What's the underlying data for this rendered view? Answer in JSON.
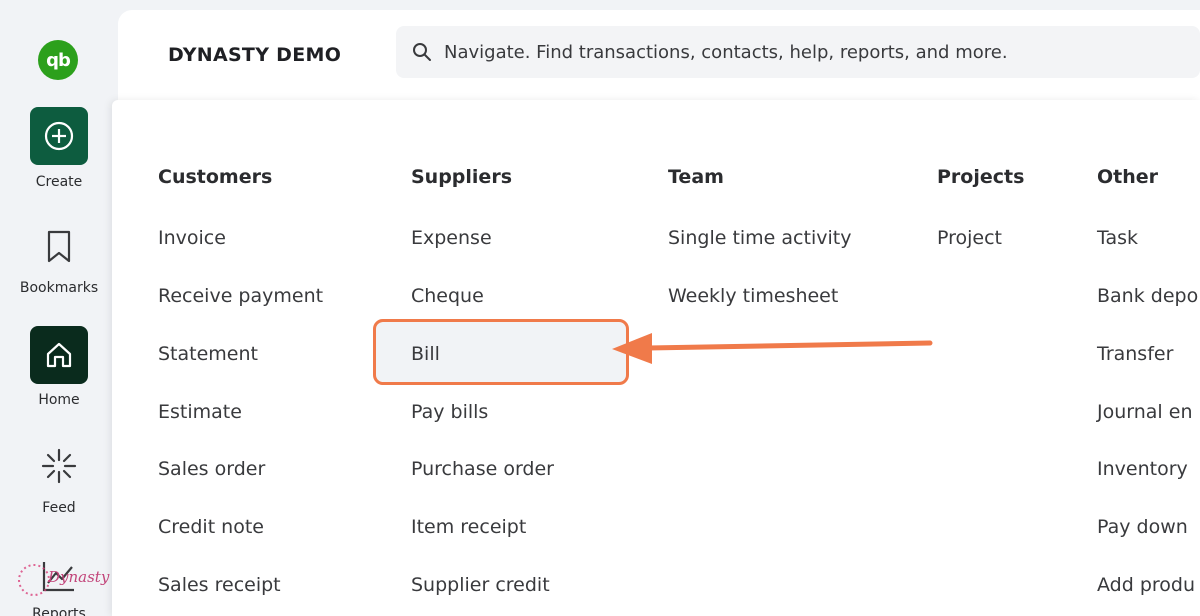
{
  "rail": {
    "create_label": "Create",
    "bookmarks_label": "Bookmarks",
    "home_label": "Home",
    "feed_label": "Feed",
    "reports_label": "Reports"
  },
  "header": {
    "company": "DYNASTY DEMO",
    "search_placeholder": "Navigate. Find transactions, contacts, help, reports, and more."
  },
  "menu": {
    "customers": {
      "title": "Customers",
      "items": [
        "Invoice",
        "Receive payment",
        "Statement",
        "Estimate",
        "Sales order",
        "Credit note",
        "Sales receipt"
      ]
    },
    "suppliers": {
      "title": "Suppliers",
      "items": [
        "Expense",
        "Cheque",
        "Bill",
        "Pay bills",
        "Purchase order",
        "Item receipt",
        "Supplier credit"
      ]
    },
    "team": {
      "title": "Team",
      "items": [
        "Single time activity",
        "Weekly timesheet"
      ]
    },
    "projects": {
      "title": "Projects",
      "items": [
        "Project"
      ]
    },
    "other": {
      "title": "Other",
      "items": [
        "Task",
        "Bank depo",
        "Transfer",
        "Journal en",
        "Inventory",
        "Pay down",
        "Add produ"
      ]
    }
  },
  "colors": {
    "brand_green": "#2ca01c",
    "create_tile": "#0d5c3f",
    "home_tile": "#0a2b1d",
    "highlight": "#f07a4a"
  },
  "watermark": "Dynasty"
}
